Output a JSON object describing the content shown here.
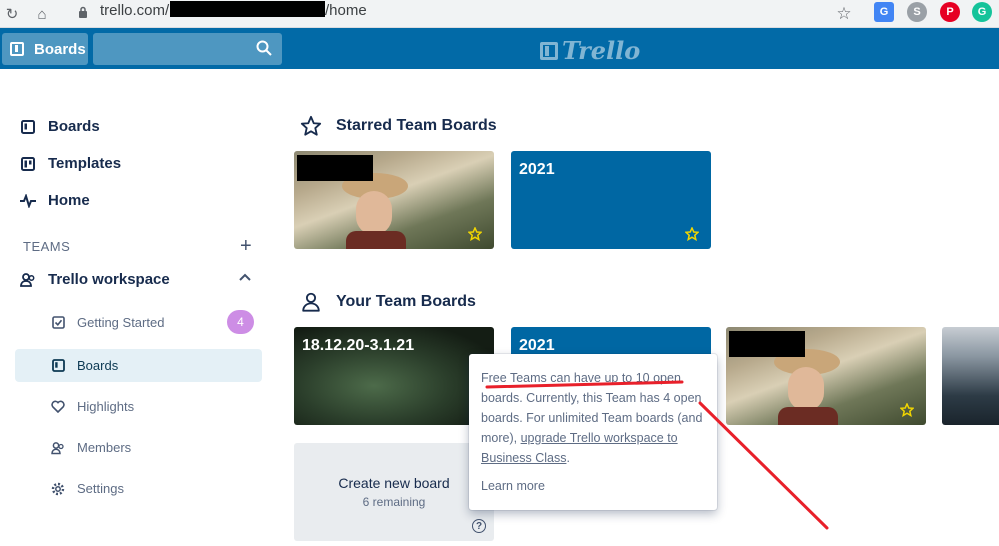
{
  "browser": {
    "url_prefix": "trello.com/",
    "url_suffix": "/home"
  },
  "header": {
    "boards_label": "Boards",
    "search_placeholder": "",
    "logo_text": "Trello"
  },
  "sidebar": {
    "items": [
      {
        "label": "Boards"
      },
      {
        "label": "Templates"
      },
      {
        "label": "Home"
      }
    ],
    "teams_label": "TEAMS",
    "workspace_label": "Trello workspace",
    "sub_items": [
      {
        "label": "Getting Started",
        "badge": "4"
      },
      {
        "label": "Boards"
      },
      {
        "label": "Highlights"
      },
      {
        "label": "Members"
      },
      {
        "label": "Settings"
      }
    ]
  },
  "main": {
    "starred_title": "Starred Team Boards",
    "team_title": "Your Team Boards",
    "starred_boards": [
      {
        "title": ""
      },
      {
        "title": "2021"
      }
    ],
    "team_boards": [
      {
        "title": "18.12.20-3.1.21"
      },
      {
        "title": "2021"
      },
      {
        "title": ""
      },
      {
        "title": ""
      }
    ],
    "create": {
      "label": "Create new board",
      "remaining": "6 remaining"
    }
  },
  "popover": {
    "text_a": "Free Teams can have up to 10 open boards. Currently, this Team has 4 open boards. For unlimited Team boards (and more), ",
    "link": "upgrade Trello workspace to Business Class",
    "text_b": ".",
    "learn_more": "Learn more"
  },
  "colors": {
    "header": "#026aa7",
    "board_blue": "#0067a3",
    "badge": "#cd8de5",
    "annotation": "#e8202a"
  }
}
